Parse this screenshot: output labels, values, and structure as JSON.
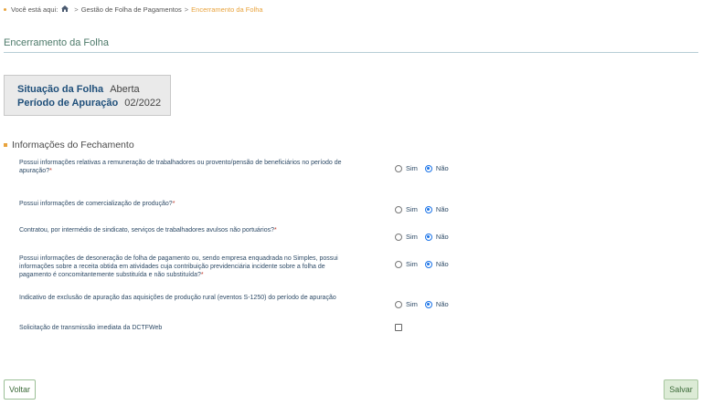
{
  "breadcrumb": {
    "prefix": "Você está aqui:",
    "sep1": ">",
    "item1": "Gestão de Folha de Pagamentos",
    "sep2": ">",
    "current": "Encerramento da Folha"
  },
  "page_title": "Encerramento da Folha",
  "status": {
    "situacao_label": "Situação da Folha",
    "situacao_value": "Aberta",
    "periodo_label": "Período de Apuração",
    "periodo_value": "02/2022"
  },
  "section_title": "Informações do Fechamento",
  "questions": [
    {
      "text": "Possui informações relativas a remuneração de trabalhadores ou provento/pensão de beneficiários no período de apuração?",
      "required": "*",
      "yes": "Sim",
      "no": "Não",
      "selected": "Não"
    },
    {
      "text": "Possui informações de comercialização de produção?",
      "required": "*",
      "yes": "Sim",
      "no": "Não",
      "selected": "Não"
    },
    {
      "text": "Contratou, por intermédio de sindicato, serviços de trabalhadores avulsos não portuários?",
      "required": "*",
      "yes": "Sim",
      "no": "Não",
      "selected": "Não"
    },
    {
      "text": "Possui informações de desoneração de folha de pagamento ou, sendo empresa enquadrada no Simples, possui informações sobre a receita obtida em atividades cuja contribuição previdenciária incidente sobre a folha de pagamento é concomitantemente substituída e não substituída?",
      "required": "*",
      "yes": "Sim",
      "no": "Não",
      "selected": "Não"
    },
    {
      "text": "Indicativo de exclusão de apuração das aquisições de produção rural (eventos S-1250) do período de apuração",
      "required": "",
      "yes": "Sim",
      "no": "Não",
      "selected": "Não"
    }
  ],
  "dctf": {
    "label": "Solicitação de transmissão imediata da DCTFWeb",
    "checked": false
  },
  "buttons": {
    "back": "Voltar",
    "save": "Salvar"
  }
}
